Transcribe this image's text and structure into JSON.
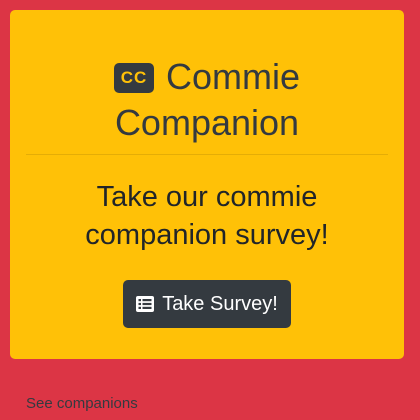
{
  "hero": {
    "icon_text": "CC",
    "title_line1": "Commie",
    "title_line2": "Companion",
    "subtitle_line1": "Take our commie",
    "subtitle_line2": "companion survey!",
    "button_label": "Take Survey!",
    "button_icon": "list-alt-icon"
  },
  "footer": {
    "link_label": "See companions"
  },
  "colors": {
    "page_background": "#dc3545",
    "card_background": "#ffc107",
    "dark": "#343a40",
    "button_text": "#ffffff"
  }
}
